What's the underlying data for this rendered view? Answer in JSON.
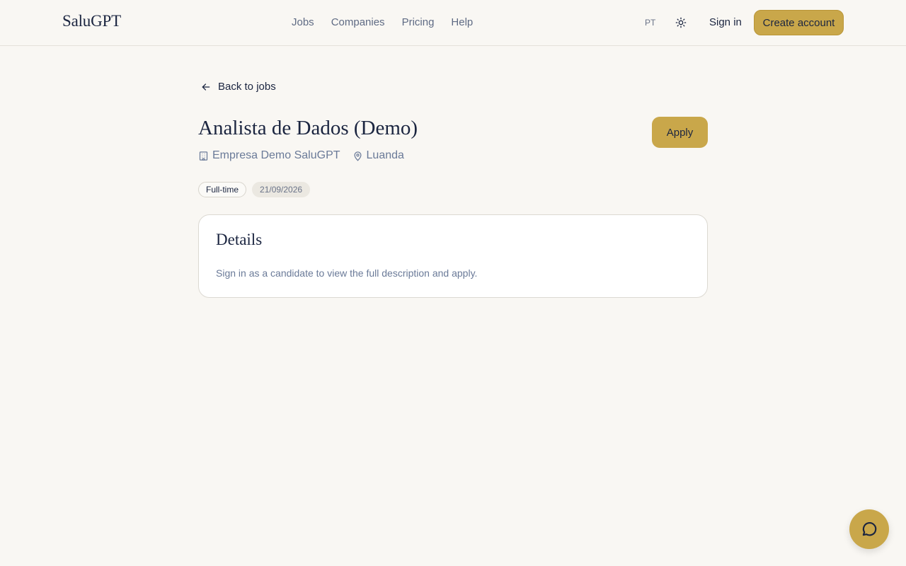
{
  "header": {
    "logo": "SaluGPT",
    "nav": [
      "Jobs",
      "Companies",
      "Pricing",
      "Help"
    ],
    "language": "PT",
    "theme_icon": "sun-icon",
    "sign_in": "Sign in",
    "create_account": "Create account"
  },
  "job": {
    "back_label": "Back to jobs",
    "title": "Analista de Dados (Demo)",
    "company": "Empresa Demo SaluGPT",
    "location": "Luanda",
    "apply_label": "Apply",
    "tags": [
      "Full-time",
      "21/09/2026"
    ]
  },
  "details": {
    "heading": "Details",
    "text": "Sign in as a candidate to view the full description and apply."
  },
  "chat": {
    "icon": "chat-bubble-icon"
  },
  "colors": {
    "accent": "#c9a74a",
    "background": "#f9f7f3",
    "text": "#1b2540",
    "muted": "#6a7a98"
  }
}
